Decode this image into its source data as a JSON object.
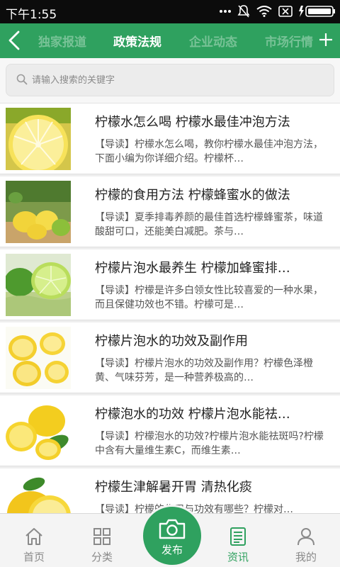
{
  "status_bar": {
    "time": "下午1:55",
    "icons": [
      "more-dots-icon",
      "mute-icon",
      "wifi-icon",
      "sim-icon",
      "battery-icon"
    ]
  },
  "top_nav": {
    "back_icon": "back-chevron-icon",
    "tabs": [
      {
        "label": "独家报道",
        "active": false
      },
      {
        "label": "政策法规",
        "active": true
      },
      {
        "label": "企业动态",
        "active": false
      },
      {
        "label": "市场行情",
        "active": false
      }
    ],
    "add_icon": "plus-icon"
  },
  "search": {
    "placeholder": "请输入搜索的关键字",
    "value": ""
  },
  "articles": [
    {
      "title": "柠檬水怎么喝 柠檬水最佳冲泡方法",
      "summary": "【导读】柠檬水怎么喝，教你柠檬水最佳冲泡方法，下面小编为你详细介绍。柠檬杯…",
      "image": "lemon-slice-thumbnail"
    },
    {
      "title": "柠檬的食用方法 柠檬蜂蜜水的做法",
      "summary": "【导读】夏季排毒养颜的最佳首选柠檬蜂蜜茶，味道酸甜可口，还能美白减肥。茶与…",
      "image": "lemons-basket-thumbnail"
    },
    {
      "title": "柠檬片泡水最养生 柠檬加蜂蜜排…",
      "summary": "【导读】柠檬是许多白领女性比较喜爱的一种水果，而且保健功效也不错。柠檬可是…",
      "image": "limes-water-thumbnail"
    },
    {
      "title": "柠檬片泡水的功效及副作用",
      "summary": "【导读】柠檬片泡水的功效及副作用？柠檬色泽橙黄、气味芬芳，是一种营养极高的…",
      "image": "lemon-halves-thumbnail"
    },
    {
      "title": "柠檬泡水的功效 柠檬片泡水能祛…",
      "summary": "【导读】柠檬泡水的功效?柠檬片泡水能祛斑吗?柠檬中含有大量维生素C，而维生素…",
      "image": "lemon-leaves-thumbnail"
    },
    {
      "title": "柠檬生津解暑开胃 清热化痰",
      "summary": "【导读】柠檬的作用与功效有哪些？柠檬对…",
      "image": "lemon-half-thumbnail"
    }
  ],
  "bottom_nav": {
    "items": [
      {
        "label": "首页",
        "icon": "home-icon",
        "active": false
      },
      {
        "label": "分类",
        "icon": "grid-icon",
        "active": false
      },
      {
        "label": "资讯",
        "icon": "news-icon",
        "active": true
      },
      {
        "label": "我的",
        "icon": "user-icon",
        "active": false
      }
    ],
    "publish": {
      "label": "发布",
      "icon": "camera-icon"
    }
  },
  "colors": {
    "accent": "#2fa15f",
    "status_bar": "#0c0c0c",
    "inactive_text": "#8a8a8a"
  }
}
